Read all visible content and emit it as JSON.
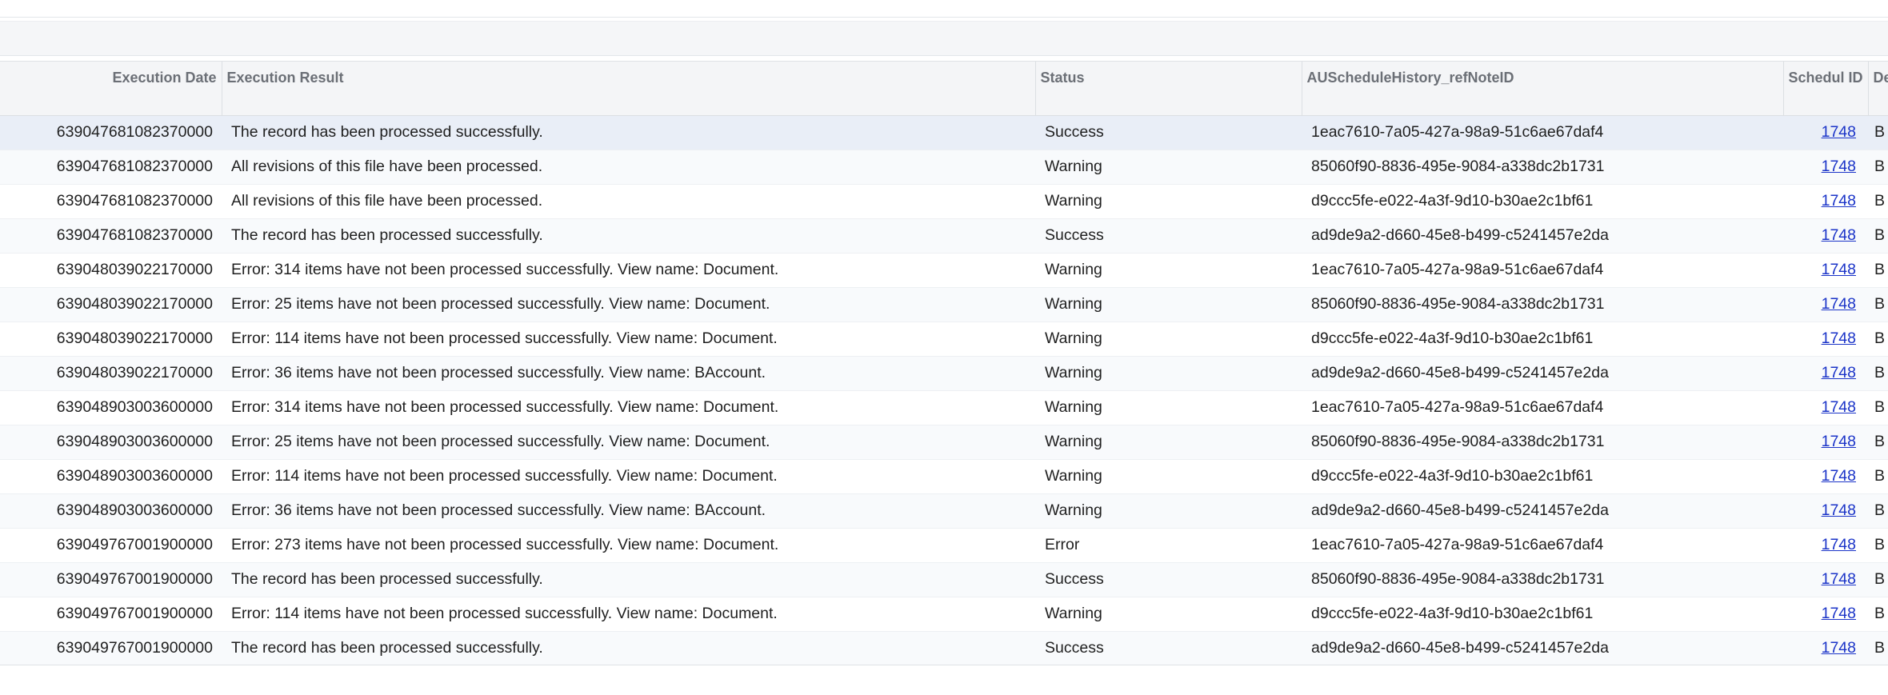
{
  "grid": {
    "columns": {
      "execution_date": "Execution Date",
      "execution_result": "Execution Result",
      "status": "Status",
      "refnote": "AUScheduleHistory_refNoteID",
      "schedule_id": "Schedul ID",
      "description": "De"
    },
    "rows": [
      {
        "date": "639047681082370000",
        "result": "The record has been processed successfully.",
        "status": "Success",
        "refnote": "1eac7610-7a05-427a-98a9-51c6ae67daf4",
        "schedule_id": "1748",
        "desc": "B"
      },
      {
        "date": "639047681082370000",
        "result": "All revisions of this file have been processed.",
        "status": "Warning",
        "refnote": "85060f90-8836-495e-9084-a338dc2b1731",
        "schedule_id": "1748",
        "desc": "B"
      },
      {
        "date": "639047681082370000",
        "result": "All revisions of this file have been processed.",
        "status": "Warning",
        "refnote": "d9ccc5fe-e022-4a3f-9d10-b30ae2c1bf61",
        "schedule_id": "1748",
        "desc": "B"
      },
      {
        "date": "639047681082370000",
        "result": "The record has been processed successfully.",
        "status": "Success",
        "refnote": "ad9de9a2-d660-45e8-b499-c5241457e2da",
        "schedule_id": "1748",
        "desc": "B"
      },
      {
        "date": "639048039022170000",
        "result": "Error: 314 items have not been processed successfully. View name: Document.",
        "status": "Warning",
        "refnote": "1eac7610-7a05-427a-98a9-51c6ae67daf4",
        "schedule_id": "1748",
        "desc": "B"
      },
      {
        "date": "639048039022170000",
        "result": "Error: 25 items have not been processed successfully. View name: Document.",
        "status": "Warning",
        "refnote": "85060f90-8836-495e-9084-a338dc2b1731",
        "schedule_id": "1748",
        "desc": "B"
      },
      {
        "date": "639048039022170000",
        "result": "Error: 114 items have not been processed successfully. View name: Document.",
        "status": "Warning",
        "refnote": "d9ccc5fe-e022-4a3f-9d10-b30ae2c1bf61",
        "schedule_id": "1748",
        "desc": "B"
      },
      {
        "date": "639048039022170000",
        "result": "Error: 36 items have not been processed successfully. View name: BAccount.",
        "status": "Warning",
        "refnote": "ad9de9a2-d660-45e8-b499-c5241457e2da",
        "schedule_id": "1748",
        "desc": "B"
      },
      {
        "date": "639048903003600000",
        "result": "Error: 314 items have not been processed successfully. View name: Document.",
        "status": "Warning",
        "refnote": "1eac7610-7a05-427a-98a9-51c6ae67daf4",
        "schedule_id": "1748",
        "desc": "B"
      },
      {
        "date": "639048903003600000",
        "result": "Error: 25 items have not been processed successfully. View name: Document.",
        "status": "Warning",
        "refnote": "85060f90-8836-495e-9084-a338dc2b1731",
        "schedule_id": "1748",
        "desc": "B"
      },
      {
        "date": "639048903003600000",
        "result": "Error: 114 items have not been processed successfully. View name: Document.",
        "status": "Warning",
        "refnote": "d9ccc5fe-e022-4a3f-9d10-b30ae2c1bf61",
        "schedule_id": "1748",
        "desc": "B"
      },
      {
        "date": "639048903003600000",
        "result": "Error: 36 items have not been processed successfully. View name: BAccount.",
        "status": "Warning",
        "refnote": "ad9de9a2-d660-45e8-b499-c5241457e2da",
        "schedule_id": "1748",
        "desc": "B"
      },
      {
        "date": "639049767001900000",
        "result": "Error: 273 items have not been processed successfully. View name: Document.",
        "status": "Error",
        "refnote": "1eac7610-7a05-427a-98a9-51c6ae67daf4",
        "schedule_id": "1748",
        "desc": "B"
      },
      {
        "date": "639049767001900000",
        "result": "The record has been processed successfully.",
        "status": "Success",
        "refnote": "85060f90-8836-495e-9084-a338dc2b1731",
        "schedule_id": "1748",
        "desc": "B"
      },
      {
        "date": "639049767001900000",
        "result": "Error: 114 items have not been processed successfully. View name: Document.",
        "status": "Warning",
        "refnote": "d9ccc5fe-e022-4a3f-9d10-b30ae2c1bf61",
        "schedule_id": "1748",
        "desc": "B"
      },
      {
        "date": "639049767001900000",
        "result": "The record has been processed successfully.",
        "status": "Success",
        "refnote": "ad9de9a2-d660-45e8-b499-c5241457e2da",
        "schedule_id": "1748",
        "desc": "B"
      }
    ]
  },
  "colors": {
    "link": "#1b34c8",
    "header_bg": "#f4f5f7",
    "selected_row": "#e9eef7",
    "alt_row": "#f8fafc"
  }
}
